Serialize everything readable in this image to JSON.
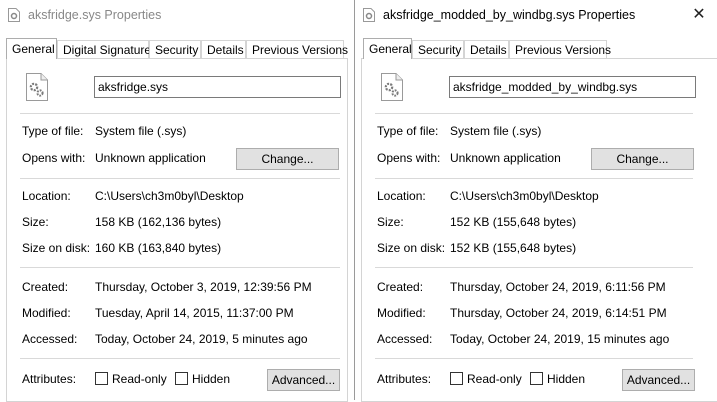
{
  "left": {
    "title": "aksfridge.sys Properties",
    "tabs": [
      "General",
      "Digital Signatures",
      "Security",
      "Details",
      "Previous Versions"
    ],
    "filename": "aksfridge.sys",
    "type_label": "Type of file:",
    "type_value": "System file (.sys)",
    "opens_label": "Opens with:",
    "opens_value": "Unknown application",
    "change_label": "Change...",
    "location_label": "Location:",
    "location_value": "C:\\Users\\ch3m0byl\\Desktop",
    "size_label": "Size:",
    "size_value": "158 KB (162,136 bytes)",
    "disk_label": "Size on disk:",
    "disk_value": "160 KB (163,840 bytes)",
    "created_label": "Created:",
    "created_value": "Thursday, October 3, 2019, 12:39:56 PM",
    "modified_label": "Modified:",
    "modified_value": "Tuesday, April 14, 2015, 11:37:00 PM",
    "accessed_label": "Accessed:",
    "accessed_value": "Today, October 24, 2019, 5 minutes ago",
    "attributes_label": "Attributes:",
    "readonly_label": "Read-only",
    "hidden_label": "Hidden",
    "advanced_label": "Advanced..."
  },
  "right": {
    "title": "aksfridge_modded_by_windbg.sys Properties",
    "close_glyph": "✕",
    "tabs": [
      "General",
      "Security",
      "Details",
      "Previous Versions"
    ],
    "filename": "aksfridge_modded_by_windbg.sys",
    "type_label": "Type of file:",
    "type_value": "System file (.sys)",
    "opens_label": "Opens with:",
    "opens_value": "Unknown application",
    "change_label": "Change...",
    "location_label": "Location:",
    "location_value": "C:\\Users\\ch3m0byl\\Desktop",
    "size_label": "Size:",
    "size_value": "152 KB (155,648 bytes)",
    "disk_label": "Size on disk:",
    "disk_value": "152 KB (155,648 bytes)",
    "created_label": "Created:",
    "created_value": "Thursday, October 24, 2019, 6:11:56 PM",
    "modified_label": "Modified:",
    "modified_value": "Thursday, October 24, 2019, 6:14:51 PM",
    "accessed_label": "Accessed:",
    "accessed_value": "Today, October 24, 2019, 15 minutes ago",
    "attributes_label": "Attributes:",
    "readonly_label": "Read-only",
    "hidden_label": "Hidden",
    "advanced_label": "Advanced..."
  },
  "icons": {
    "title": "system-file-icon",
    "file": "gear-file-icon",
    "close": "close-icon"
  }
}
